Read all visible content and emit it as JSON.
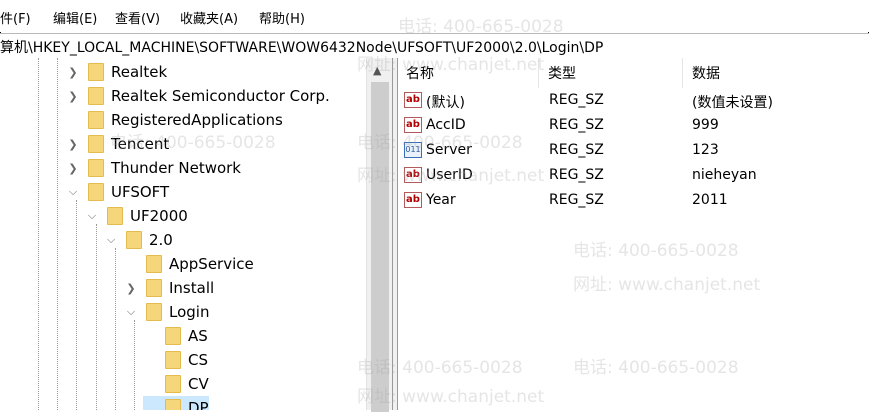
{
  "menu": [
    {
      "label": "件(F)"
    },
    {
      "label": "编辑(E)"
    },
    {
      "label": "查看(V)"
    },
    {
      "label": "收藏夹(A)"
    },
    {
      "label": "帮助(H)"
    }
  ],
  "address": {
    "path": "算机\\HKEY_LOCAL_MACHINE\\SOFTWARE\\WOW6432Node\\UFSOFT\\UF2000\\2.0\\Login\\DP"
  },
  "tree": [
    {
      "label": "Realtek",
      "chevron": "right"
    },
    {
      "label": "Realtek Semiconductor Corp.",
      "chevron": "right"
    },
    {
      "label": "RegisteredApplications",
      "chevron": ""
    },
    {
      "label": "Tencent",
      "chevron": "right"
    },
    {
      "label": "Thunder Network",
      "chevron": "right"
    },
    {
      "label": "UFSOFT",
      "chevron": "down"
    },
    {
      "label": "UF2000",
      "chevron": "down"
    },
    {
      "label": "2.0",
      "chevron": "down"
    },
    {
      "label": "AppService",
      "chevron": ""
    },
    {
      "label": "Install",
      "chevron": "right"
    },
    {
      "label": "Login",
      "chevron": "down"
    },
    {
      "label": "AS",
      "chevron": ""
    },
    {
      "label": "CS",
      "chevron": ""
    },
    {
      "label": "CV",
      "chevron": ""
    },
    {
      "label": "DP",
      "chevron": ""
    }
  ],
  "values_header": {
    "name": "名称",
    "type": "类型",
    "data": "数据"
  },
  "values": [
    {
      "name": "(默认)",
      "type": "REG_SZ",
      "data": "(数值未设置)",
      "icon": "string-value-icon"
    },
    {
      "name": "AccID",
      "type": "REG_SZ",
      "data": "999",
      "icon": "string-value-icon"
    },
    {
      "name": "Server",
      "type": "REG_SZ",
      "data": "123",
      "icon": "binary-value-icon"
    },
    {
      "name": "UserID",
      "type": "REG_SZ",
      "data": "nieheyan",
      "icon": "string-value-icon"
    },
    {
      "name": "Year",
      "type": "REG_SZ",
      "data": "2011",
      "icon": "string-value-icon"
    }
  ],
  "watermark": {
    "phone": "电话: 400-665-0028",
    "site": "网址: www.chanjet.net"
  }
}
